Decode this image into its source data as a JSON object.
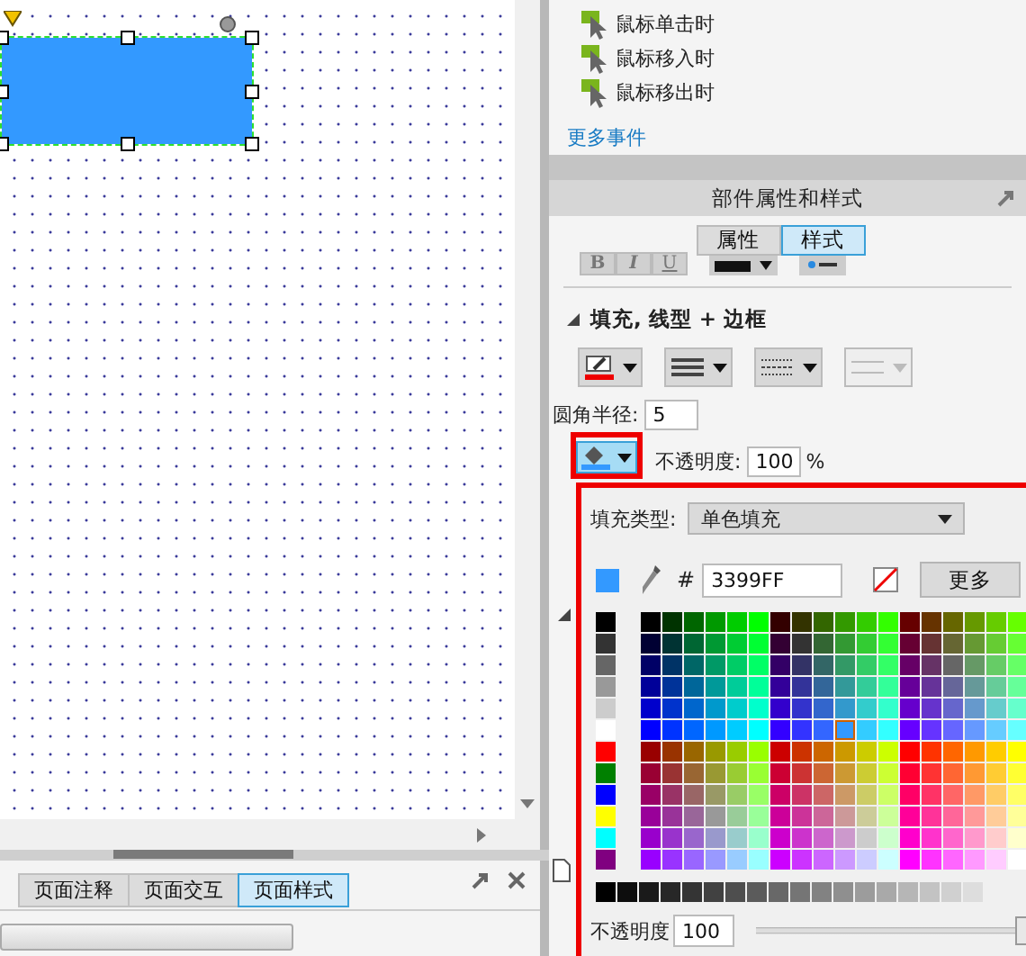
{
  "canvas": {
    "shape": {
      "selected": true
    }
  },
  "events": [
    {
      "label": "鼠标单击时"
    },
    {
      "label": "鼠标移入时"
    },
    {
      "label": "鼠标移出时"
    }
  ],
  "more_events_link": "更多事件",
  "style_panel": {
    "title": "部件属性和样式",
    "tabs": [
      {
        "label": "属性",
        "selected": false
      },
      {
        "label": "样式",
        "selected": true
      }
    ],
    "text_buttons": [
      "B",
      "I",
      "U"
    ],
    "section": {
      "title": "填充, 线型 + 边框",
      "expanded": true
    },
    "corner_radius": {
      "label": "圆角半径:",
      "value": "5"
    },
    "opacity": {
      "label": "不透明度:",
      "value": "100",
      "unit": "%"
    }
  },
  "fill_popup": {
    "type_label": "填充类型:",
    "type_value": "单色填充",
    "hash": "#",
    "hex": "3399FF",
    "more_button": "更多",
    "opacity_label": "不透明度",
    "opacity_value": "100",
    "opacity_slider": {
      "level": 0.95
    }
  },
  "bottom_panel": {
    "tabs": [
      {
        "label": "页面注释",
        "selected": false
      },
      {
        "label": "页面交互",
        "selected": false
      },
      {
        "label": "页面样式",
        "selected": true
      }
    ]
  }
}
